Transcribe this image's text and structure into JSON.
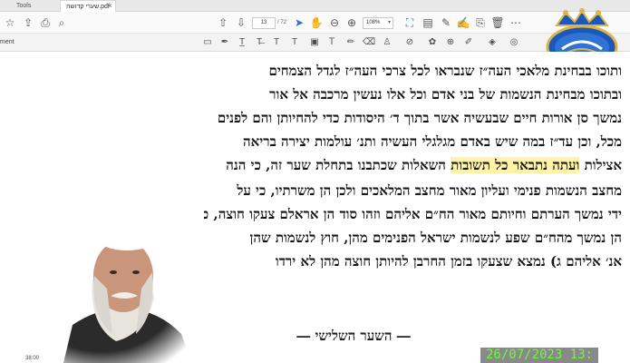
{
  "tabs": {
    "home": "",
    "tools": "Tools",
    "document": "שערי קדושה.pdf",
    "close": "×"
  },
  "toolbar": {
    "page_current": "13",
    "page_total": "/ 72",
    "zoom": "108%"
  },
  "comment_bar": {
    "label": "ment"
  },
  "document": {
    "lines": [
      "ותוכו בבחינת מלאכי העה״ז שנבראו לכל צרכי העה״ז לגדל הצמחים",
      "ובתוכו מבחינת הנשמות של בני אדם וכל אלו נעשין מרכבה אל אור",
      "נמשך סן אורות חיים שבעשיה אשר בתוך ד׳ היסודות כדי להחיותן והם לפנים",
      "מכל, וכן עד״ז במה שיש באדם מגלגלי העשיה ותנ׳ עולמות יצירה בריאה",
      "אצילות"
    ],
    "line5_highlight": "ועתה נתבאר כל תשובות",
    "line5_rest": "השאלות שכתבנו בתחלת שער זה, כי הנה",
    "lines_after": [
      "מחצב הנשמות פנימי ועליון מאור מחצב המלאכים ולכן הן משרתיו, כי על",
      "ידי נמשך הערתם וחיותם מאור הח״ם אליהם וזהו סוד הן אראלם צעקו חוצה, כי",
      "הן נמשך מהח״ם שפע לנשמות ישראל הפנימים מהן, חוץ לנשמות שהן",
      "אנ׳ אליהם ג) נמצא שצעקו בזמן החרבן להיותן חוצה מהן לא ירדו"
    ],
    "heading": "― השער השלישי ―"
  },
  "logo": {
    "text": "קול הלשון"
  },
  "overlay": {
    "timestamp": "26/07/2023 13:",
    "left_clock": "38:00"
  },
  "colors": {
    "highlight": "#fff3a8",
    "timestamp_text": "#66ff33",
    "logo_blue": "#1d58b8"
  },
  "icons": {
    "toolbar": [
      "star-icon",
      "print-icon",
      "zoom-icon",
      "page-up-icon",
      "page-down-icon",
      "select-icon",
      "hand-icon",
      "zoom-out-icon",
      "zoom-in-icon",
      "fit-icon",
      "sign-icon",
      "attach-icon",
      "delete-icon",
      "more-icon"
    ],
    "comment": [
      "comment-icon",
      "pen-icon",
      "underline-icon",
      "strikethrough-icon",
      "text-icon",
      "text-box-icon",
      "sticky-note-icon",
      "draw-icon",
      "eraser-icon",
      "stamp-icon",
      "attach-file-icon",
      "shapes-icon",
      "pin-icon",
      "fill-icon",
      "hide-icon"
    ]
  }
}
